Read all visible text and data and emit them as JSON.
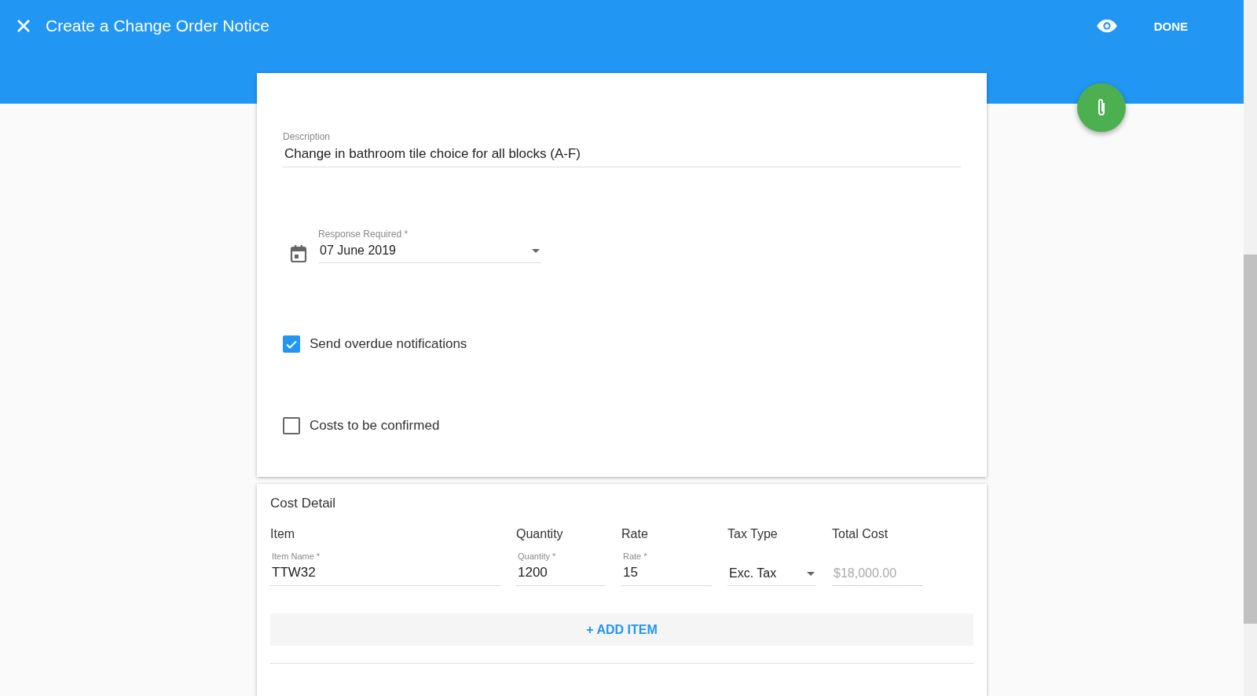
{
  "app_bar": {
    "title": "Create a Change Order Notice",
    "action": "DONE"
  },
  "form": {
    "description": {
      "label": "Description",
      "value": "Change in bathroom tile choice for all blocks (A-F)"
    },
    "response_required": {
      "label": "Response Required *",
      "value": "07 June 2019"
    },
    "checkboxes": [
      {
        "label": "Send overdue notifications",
        "checked": true
      },
      {
        "label": "Costs to be confirmed",
        "checked": false
      }
    ]
  },
  "cost_detail": {
    "title": "Cost Detail",
    "columns": [
      "Item",
      "Quantity",
      "Rate",
      "Tax Type",
      "Total Cost"
    ],
    "rows": [
      {
        "item_label": "Item Name *",
        "item": "TTW32",
        "quantity_label": "Quantity *",
        "quantity": "1200",
        "rate_label": "Rate *",
        "rate": "15",
        "tax_type": "Exc. Tax",
        "total": "$18,000.00"
      }
    ],
    "add_button": "+ ADD ITEM"
  }
}
